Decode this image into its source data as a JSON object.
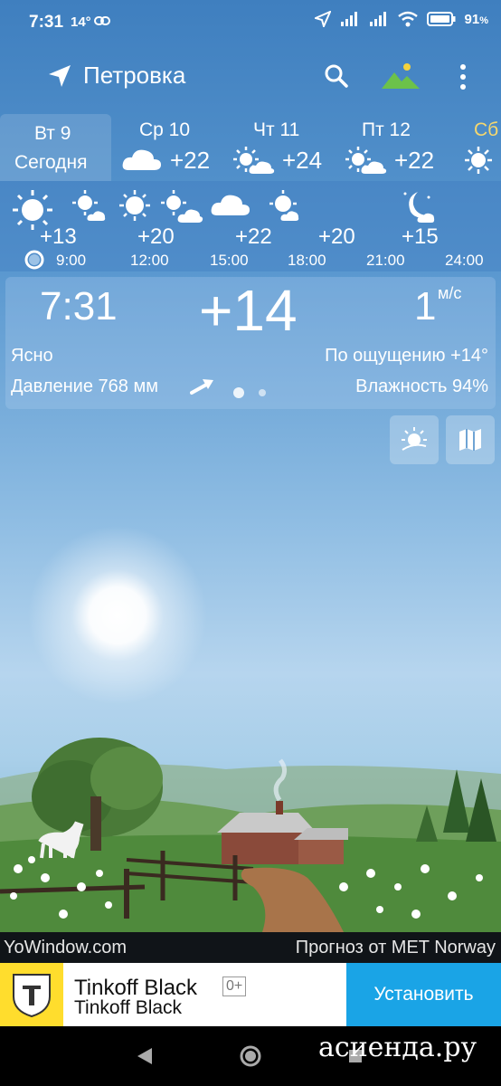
{
  "status_bar": {
    "time": "7:31",
    "temp": "14°",
    "battery": "91"
  },
  "app_bar": {
    "location": "Петровка"
  },
  "days": [
    {
      "label": "Вт 9",
      "sublabel": "Сегодня",
      "active": true
    },
    {
      "label": "Ср 10",
      "temp": "+22",
      "icon": "cloud-icon"
    },
    {
      "label": "Чт 11",
      "temp": "+24",
      "icon": "partly-cloudy-icon"
    },
    {
      "label": "Пт 12",
      "temp": "+22",
      "icon": "partly-cloudy-icon"
    },
    {
      "label": "Сб",
      "icon": "sun-icon"
    }
  ],
  "hourly": {
    "temps": [
      "+13",
      "+20",
      "+22",
      "+20",
      "+15"
    ],
    "times": [
      "9:00",
      "12:00",
      "15:00",
      "18:00",
      "21:00",
      "24:00"
    ]
  },
  "current": {
    "time": "7:31",
    "temp": "+14",
    "wind": "1",
    "wind_unit": "м/с",
    "condition": "Ясно",
    "feels_like": "По ощущению +14°",
    "pressure": "Давление 768 мм",
    "humidity": "Влажность 94%"
  },
  "credits": {
    "left": "YoWindow.com",
    "right": "Прогноз от MET Norway"
  },
  "ad": {
    "title": "Tinkoff Black",
    "age": "0+",
    "subtitle": "Tinkoff Black",
    "button": "Установить"
  },
  "watermark": "асиенда.ру",
  "colors": {
    "accent_yellow": "#ffdd2d",
    "install_blue": "#1aa4e6",
    "day_highlight": "#f5d76e"
  }
}
